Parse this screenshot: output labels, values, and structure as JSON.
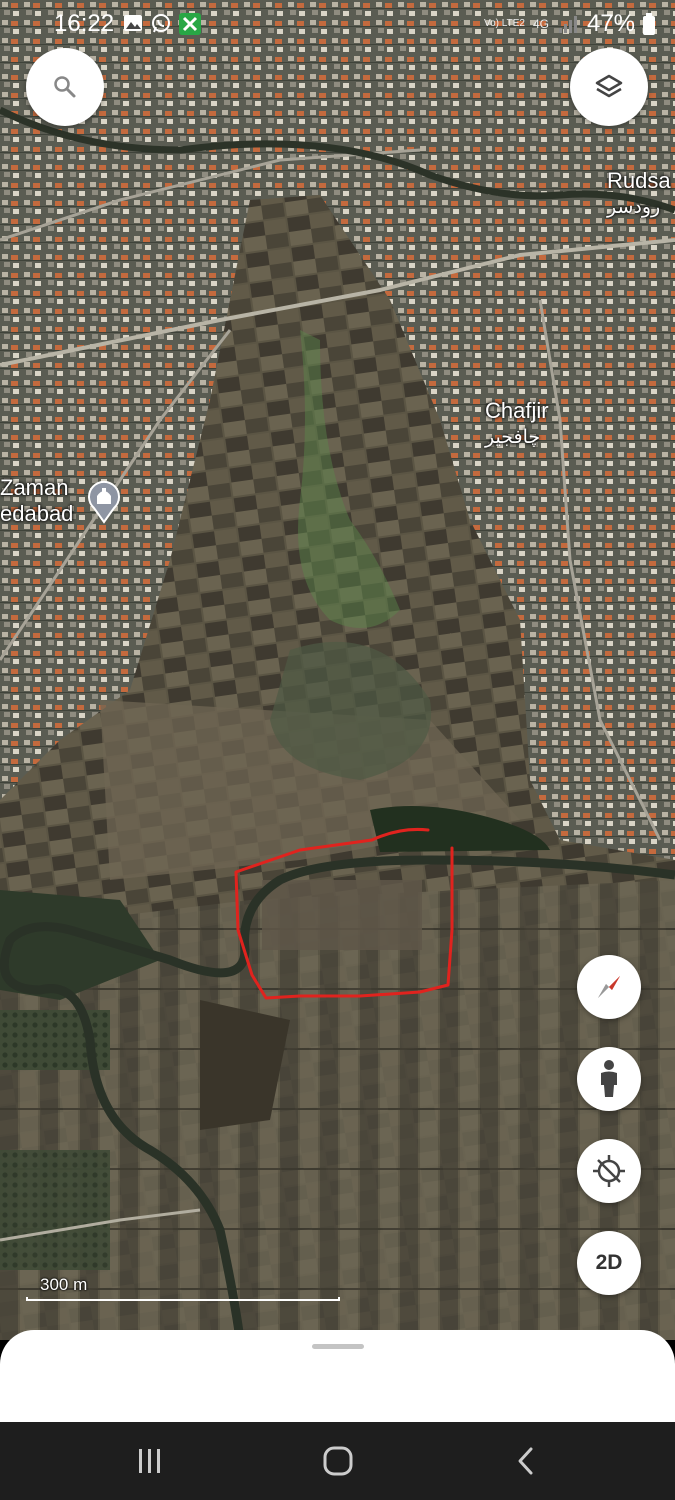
{
  "status_bar": {
    "time": "16:22",
    "network": "Vo) LTE2",
    "network_type": "4G",
    "battery": "47%"
  },
  "map": {
    "places": [
      {
        "name": "Rudsa",
        "local": "رودسر"
      },
      {
        "name": "Chafjir",
        "local": "چافجیر"
      },
      {
        "name": "Zaman",
        "local": "edabad"
      }
    ],
    "scale_label": "300 m",
    "annotation_color": "#e0231e"
  },
  "controls": {
    "search_icon": "search-icon",
    "layers_icon": "layers-icon",
    "compass_icon": "compass-icon",
    "street_view_icon": "person-icon",
    "location_icon": "gps-off-icon",
    "view_mode_label": "2D"
  },
  "navigation": {
    "recent_icon": "recent-apps-icon",
    "home_icon": "home-icon",
    "back_icon": "back-icon"
  }
}
